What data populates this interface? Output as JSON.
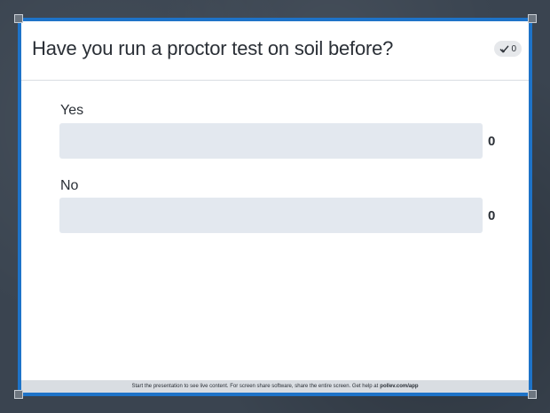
{
  "slide": {
    "title": "Have you run a proctor test on soil before?",
    "response_count": "0",
    "response_icon": "checkmark-icon"
  },
  "options": [
    {
      "label": "Yes",
      "count": "0",
      "fraction": 0
    },
    {
      "label": "No",
      "count": "0",
      "fraction": 0
    }
  ],
  "footer": {
    "text": "Start the presentation to see live content. For screen share software, share the entire screen. Get help at",
    "link": "pollev.com/app"
  },
  "colors": {
    "accent": "#1e73c8",
    "bar_track": "#e3e8ef",
    "footer_bg": "#d9dde2"
  }
}
